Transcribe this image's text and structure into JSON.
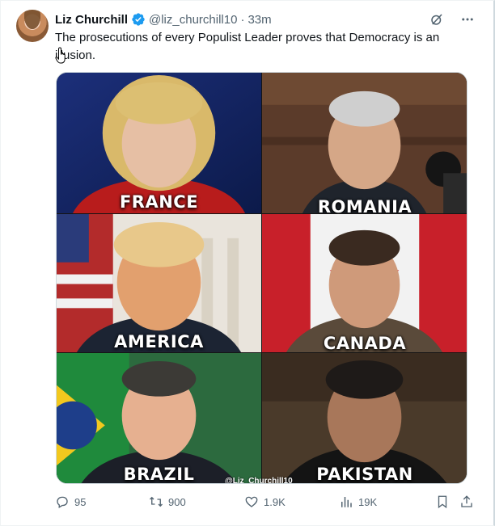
{
  "tweet": {
    "author_name": "Liz Churchill",
    "handle": "@liz_churchill10",
    "separator": "·",
    "time": "33m",
    "text": "The prosecutions of every Populist Leader proves that Democracy is an illusion."
  },
  "media": {
    "panels": [
      {
        "country": "FRANCE"
      },
      {
        "country": "ROMANIA"
      },
      {
        "country": "AMERICA"
      },
      {
        "country": "CANADA"
      },
      {
        "country": "BRAZIL"
      },
      {
        "country": "PAKISTAN"
      }
    ],
    "watermark": "@Liz_Churchill10"
  },
  "actions": {
    "replies": "95",
    "reposts": "900",
    "likes": "1.9K",
    "views": "19K"
  },
  "colors": {
    "text": "#0f1419",
    "muted": "#536471",
    "verified": "#1d9bf0"
  }
}
